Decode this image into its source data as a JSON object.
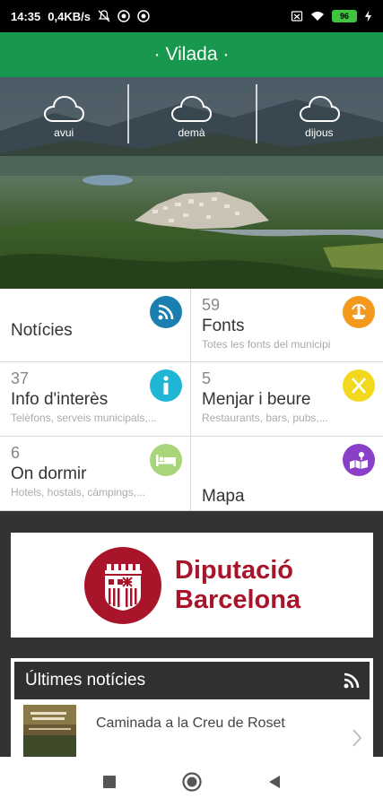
{
  "status_bar": {
    "time": "14:35",
    "network_speed": "0,4KB/s",
    "battery": "96"
  },
  "app_bar": {
    "title": "· Vilada ·"
  },
  "weather": {
    "days": [
      {
        "label": "avui",
        "icon": "cloud-icon"
      },
      {
        "label": "demà",
        "icon": "cloud-icon"
      },
      {
        "label": "dijous",
        "icon": "cloud-icon"
      }
    ]
  },
  "tiles": {
    "noticies": {
      "count": "",
      "title": "Notícies",
      "subtitle": "",
      "icon": "rss-icon",
      "color": "#1a7fb0"
    },
    "fonts": {
      "count": "59",
      "title": "Fonts",
      "subtitle": "Totes les fonts del municipi",
      "icon": "fountain-icon",
      "color": "#f39a1e"
    },
    "info": {
      "count": "37",
      "title": "Info d'interès",
      "subtitle": "Telèfons, serveis municipals,...",
      "icon": "info-icon",
      "color": "#1fb6d6"
    },
    "menjar": {
      "count": "5",
      "title": "Menjar i beure",
      "subtitle": "Restaurants, bars, pubs,...",
      "icon": "cutlery-icon",
      "color": "#f2d91e"
    },
    "dormir": {
      "count": "6",
      "title": "On dormir",
      "subtitle": "Hotels, hostals, càmpings,...",
      "icon": "bed-icon",
      "color": "#a8d57a"
    },
    "mapa": {
      "count": "",
      "title": "Mapa",
      "subtitle": "",
      "icon": "map-icon",
      "color": "#8a3fc9"
    }
  },
  "banner": {
    "line1": "Diputació",
    "line2": "Barcelona",
    "brand_color": "#a8152a"
  },
  "news": {
    "header": "Últimes notícies",
    "items": [
      {
        "title": "Caminada a la Creu de Roset"
      }
    ]
  }
}
